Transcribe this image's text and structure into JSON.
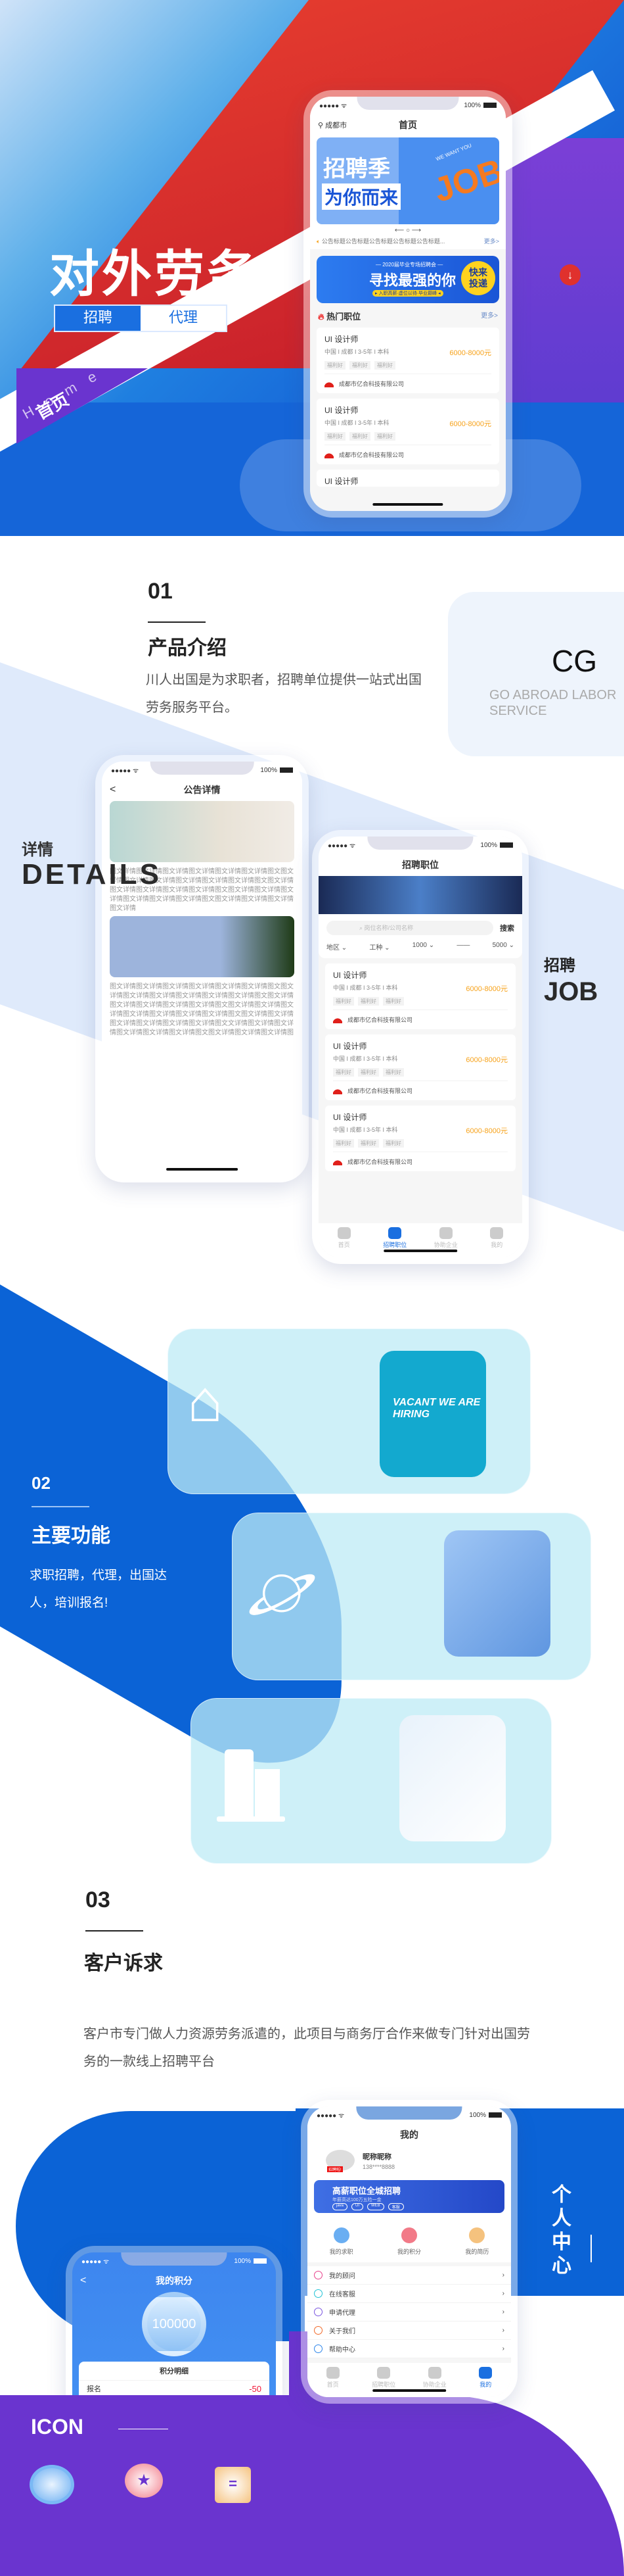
{
  "hero": {
    "title": "对外劳务",
    "tabs": [
      "招聘",
      "代理"
    ],
    "flag": "首页",
    "subtitle": "Home page",
    "colors": {
      "blue": "#1565d8",
      "red": "#e0312d",
      "purple": "#6a34cf"
    }
  },
  "home_phone": {
    "status": {
      "battery": "100%"
    },
    "location": "成都市",
    "title": "首页",
    "banner": {
      "line1": "招聘季",
      "line2": "为你而来",
      "art": "JOB",
      "tag": "WE WANT YOU"
    },
    "notice": "公告标题公告标题公告标题公告标题公告标题...",
    "notice_more": "更多>",
    "banner2": {
      "top": "— 2020届毕业专场招聘会 —",
      "main": "寻找最强的你",
      "sub": "▸ 入职高薪·虚位以待·毕业巅峰 ◂",
      "badge": "快来投递"
    },
    "hot": {
      "title": "热门职位",
      "more": "更多>"
    },
    "jobs": [
      {
        "title": "UI 设计师",
        "meta": "中国 I 成都 I 3-5年 I 本科",
        "salary": "6000-8000元",
        "tags": [
          "福利好",
          "福利好",
          "福利好"
        ],
        "company": "成都市亿合科技有限公司"
      },
      {
        "title": "UI 设计师",
        "meta": "中国 I 成都 I 3-5年 I 本科",
        "salary": "6000-8000元",
        "tags": [
          "福利好",
          "福利好",
          "福利好"
        ],
        "company": "成都市亿合科技有限公司"
      },
      {
        "title": "UI 设计师"
      }
    ]
  },
  "intro": {
    "num": "01",
    "title": "产品介绍",
    "desc": "川人出国是为求职者，招聘单位提供一站式出国劳务服务平台。",
    "cg": "CG",
    "cg_sub": "GO ABROAD LABOR SERVICE"
  },
  "details": {
    "label": "详情",
    "en": "DETAILS",
    "phone": {
      "battery": "100%",
      "title": "公告详情",
      "back": "<",
      "p1": "图文详情图文详情图文详情图文详情图文详情图文详情图文图文详情图文详情图文详情图文详情图文详情图文详情图文图文详情图文详情图文详情图文详情图文详情图文图文详情图文详情图文详情图文详情图文详情图文详情图文图文详情图文详情图文详情图文详情",
      "p2": "图文详情图文详情图文详情图文详情图文详情图文详情图文图文详情图文详情图文详情图文详情图文详情图文详情图文图文详情图文详情图文详情图文详情图文详情图文图文详情图文详情图文详情图文详情图文详情图文详情图文详情图文图文详情图文详情图文详情图文详情图文详情图文详情图文文详情图文详情图文详情图文详情图文详情图文详情图文图文详情图文详情图文详情图"
    }
  },
  "job_section": {
    "label": "招聘",
    "en": "JOB",
    "phone": {
      "battery": "100%",
      "title": "招聘职位",
      "search_placeholder": "岗位名称/公司名称",
      "search_btn": "搜索",
      "filters": [
        "地区 ⌄",
        "工种 ⌄",
        "1000 ⌄",
        "——",
        "5000 ⌄"
      ],
      "jobs": [
        {
          "title": "UI 设计师",
          "meta": "中国 I 成都 I 3-5年 I 本科",
          "salary": "6000-8000元",
          "tags": [
            "福利好",
            "福利好",
            "福利好"
          ],
          "company": "成都市亿合科技有限公司"
        },
        {
          "title": "UI 设计师",
          "meta": "中国 I 成都 I 3-5年 I 本科",
          "salary": "6000-8000元",
          "tags": [
            "福利好",
            "福利好",
            "福利好"
          ],
          "company": "成都市亿合科技有限公司"
        },
        {
          "title": "UI 设计师",
          "meta": "中国 I 成都 I 3-5年 I 本科",
          "salary": "6000-8000元",
          "tags": [
            "福利好",
            "福利好",
            "福利好"
          ],
          "company": "成都市亿合科技有限公司"
        }
      ],
      "tabbar": [
        {
          "label": "首页",
          "active": false
        },
        {
          "label": "招聘职位",
          "active": true
        },
        {
          "label": "协助企业",
          "active": false
        },
        {
          "label": "我的",
          "active": false
        }
      ]
    }
  },
  "features": {
    "num": "02",
    "title": "主要功能",
    "desc": "求职招聘，代理，出国达人，培训报名!",
    "cards": [
      {
        "icon": "house-icon",
        "image_text": "VACANT  WE ARE HIRING"
      },
      {
        "icon": "planet-icon",
        "image_text": ""
      },
      {
        "icon": "building-icon",
        "image_text": ""
      }
    ]
  },
  "needs": {
    "num": "03",
    "title": "客户诉求",
    "desc": "客户市专门做人力资源劳务派遣的，此项目与商务厅合作来做专门针对出国劳务的一款线上招聘平台"
  },
  "personal": {
    "label": "个人中心",
    "phone": {
      "battery": "100%",
      "title": "我的",
      "nickname": "昵称昵称",
      "phone": "138****8888",
      "avatar_badge": "招聘啦!",
      "banner": {
        "main": "高薪职位全城招聘",
        "sub": "年薪高达100万五险一金",
        "tags": [
          "java",
          "UI",
          "WEB",
          "客服"
        ]
      },
      "shortcuts": [
        "我的求职",
        "我的积分",
        "我的简历"
      ],
      "menu": [
        {
          "label": "我的顾问",
          "icon": "advisor-icon",
          "color": "#e8418c"
        },
        {
          "label": "在线客服",
          "icon": "headset-icon",
          "color": "#22c3d6"
        },
        {
          "label": "申请代理",
          "icon": "agent-icon",
          "color": "#7a55e0"
        },
        {
          "label": "关于我们",
          "icon": "info-icon",
          "color": "#f06a2a"
        },
        {
          "label": "帮助中心",
          "icon": "help-icon",
          "color": "#2e86ea"
        }
      ],
      "tabbar": [
        {
          "label": "首页",
          "active": false
        },
        {
          "label": "招聘职位",
          "active": false
        },
        {
          "label": "协助企业",
          "active": false
        },
        {
          "label": "我的",
          "active": true
        }
      ]
    }
  },
  "points_phone": {
    "battery": "100%",
    "back": "<",
    "title": "我的积分",
    "points": "100000",
    "detail_title": "积分明细",
    "rows": [
      {
        "label": "报名",
        "value": "-50"
      }
    ]
  },
  "icons": {
    "title": "ICON",
    "items": [
      "job-search-icon",
      "points-medal-icon",
      "resume-icon"
    ]
  }
}
